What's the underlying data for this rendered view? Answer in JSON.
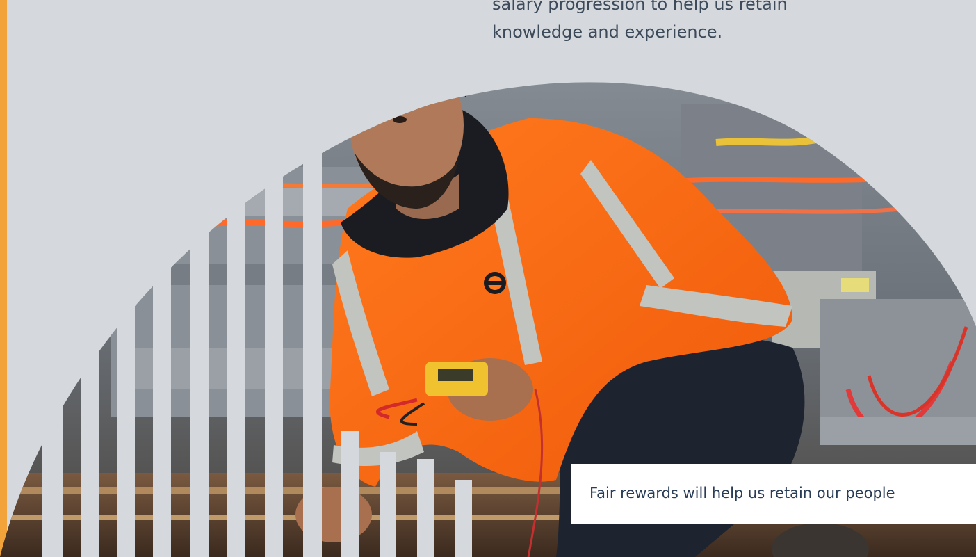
{
  "body_text": {
    "line1": "salary progression to help us retain",
    "line2": "knowledge and experience."
  },
  "caption": {
    "text": "Fair rewards will help us retain our people"
  },
  "colors": {
    "page_background": "#d5d9dd",
    "accent_bar": "#f2a43a",
    "hi_vis_orange": "#ff6a14",
    "reflective_stripe": "#bfc2bd",
    "caption_background": "#ffffff",
    "caption_text": "#2a3d57",
    "body_text": "#3d4a5a"
  },
  "photo": {
    "subject": "rail worker in orange hi-vis jacket holding a multimeter beside the track"
  }
}
